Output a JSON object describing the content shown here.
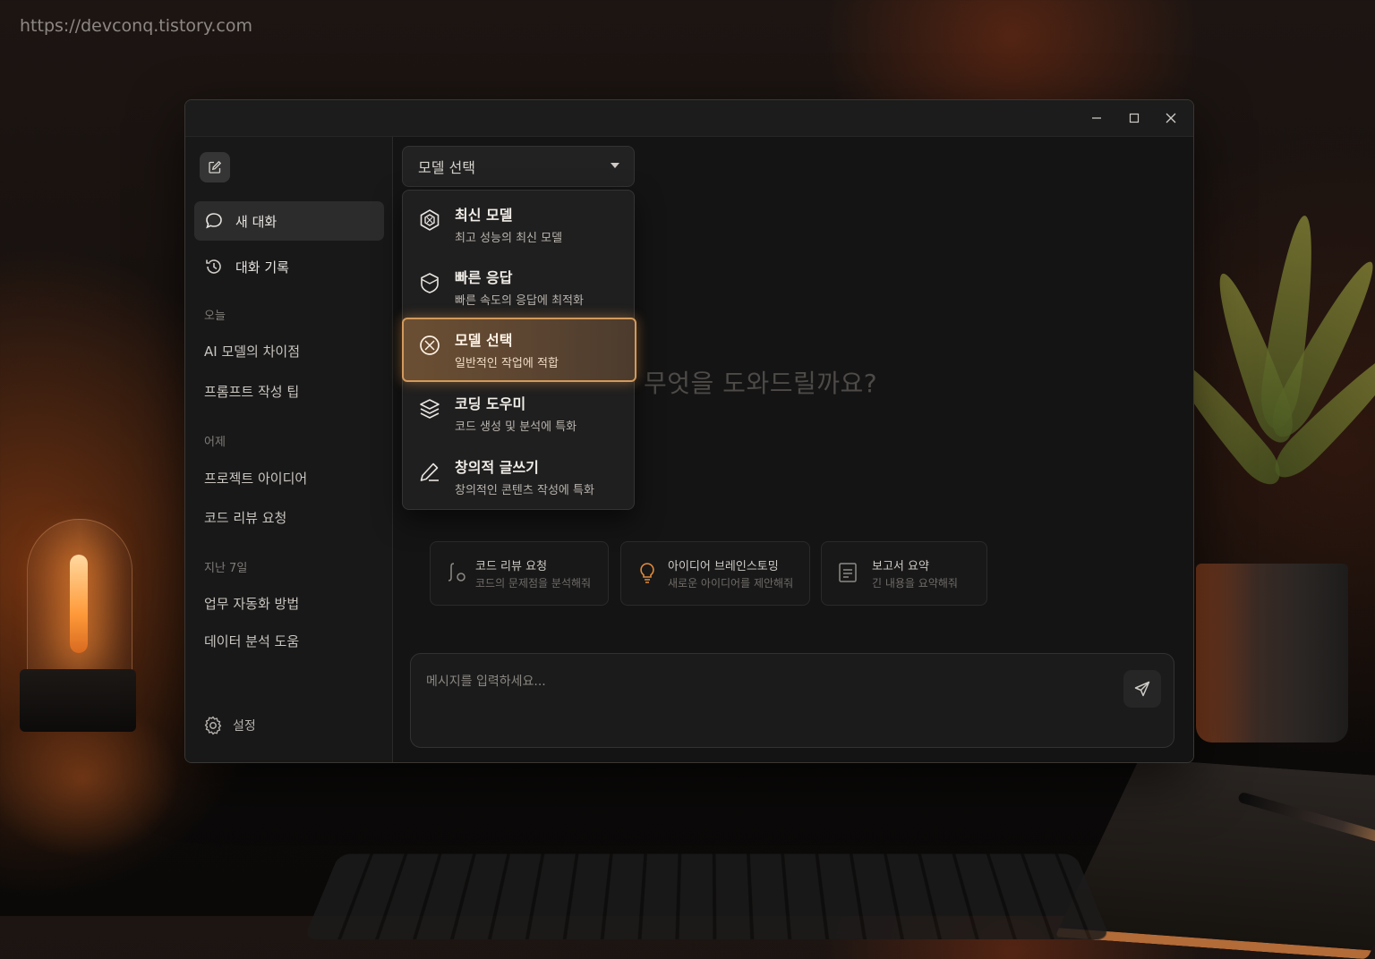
{
  "watermark": "https://devconq.tistory.com",
  "sidebar": {
    "new_chat": "새 대화",
    "history": "대화 기록",
    "sections": [
      {
        "label": "오늘",
        "items": [
          "AI 모델의 차이점",
          "프롬프트 작성 팁"
        ]
      },
      {
        "label": "어제",
        "items": [
          "프로젝트 아이디어",
          "코드 리뷰 요청"
        ]
      },
      {
        "label": "지난 7일",
        "items": [
          "업무 자동화 방법",
          "데이터 분석 도움"
        ]
      }
    ],
    "settings": "설정"
  },
  "model_select": {
    "label": "모델 선택",
    "options": [
      {
        "title": "최신 모델",
        "desc": "최고 성능의 최신 모델",
        "icon": "hexagon-icon",
        "selected": false
      },
      {
        "title": "빠른 응답",
        "desc": "빠른 속도의 응답에 최적화",
        "icon": "shield-icon",
        "selected": false
      },
      {
        "title": "모델 선택",
        "desc": "일반적인 작업에 적합",
        "icon": "compass-icon",
        "selected": true
      },
      {
        "title": "코딩 도우미",
        "desc": "코드 생성 및 분석에 특화",
        "icon": "layers-icon",
        "selected": false
      },
      {
        "title": "창의적 글쓰기",
        "desc": "창의적인 콘텐츠 작성에 특화",
        "icon": "pencil-icon",
        "selected": false
      }
    ]
  },
  "hero": "무엇을 도와드릴까요?",
  "suggestions": [
    {
      "title": "코드 리뷰 요청",
      "desc": "코드의 문제점을 분석해줘",
      "icon": "code-icon"
    },
    {
      "title": "아이디어 브레인스토밍",
      "desc": "새로운 아이디어를 제안해줘",
      "icon": "lightbulb-icon"
    },
    {
      "title": "보고서 요약",
      "desc": "긴 내용을 요약해줘",
      "icon": "document-icon"
    }
  ],
  "composer": {
    "placeholder": "메시지를 입력하세요..."
  },
  "colors": {
    "accent": "#d29a5c",
    "lightbulb": "#e08a3c"
  }
}
